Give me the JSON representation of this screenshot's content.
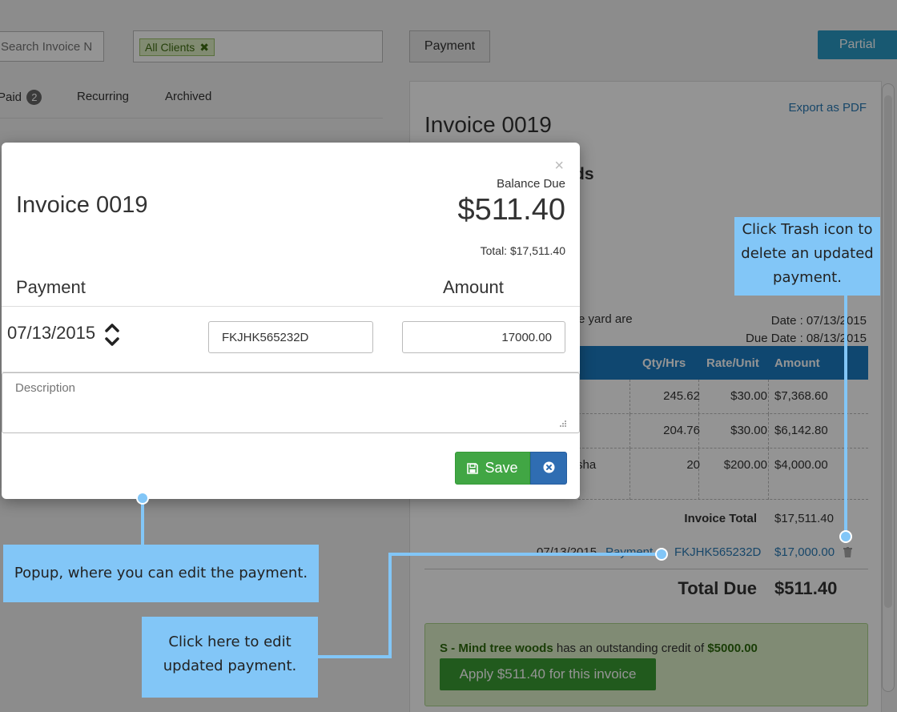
{
  "toolbar": {
    "search_placeholder": "Search Invoice N",
    "client_tag": "All Clients",
    "client_tag_remove": "✖",
    "payment_button": "Payment",
    "partial_button": "Partial"
  },
  "tabs": [
    {
      "label": "Paid",
      "badge": "2"
    },
    {
      "label": "Recurring"
    },
    {
      "label": "Archived"
    }
  ],
  "invoice": {
    "export_link": "Export as PDF",
    "title": "Invoice 0019",
    "client_fragment": "ds",
    "address_fragment": "e yard are",
    "date": "Date : 07/13/2015",
    "due_date": "Due Date : 08/13/2015",
    "columns": {
      "qty": "Qty/Hrs",
      "rate": "Rate/Unit",
      "amount": "Amount"
    },
    "rows": [
      {
        "desc": "",
        "qty": "245.62",
        "rate": "$30.00",
        "amount": "$7,368.60"
      },
      {
        "desc": "",
        "qty": "204.76",
        "rate": "$30.00",
        "amount": "$6,142.80"
      },
      {
        "desc": "sha",
        "qty": "20",
        "rate": "$200.00",
        "amount": "$4,000.00"
      }
    ],
    "invoice_total_label": "Invoice Total",
    "invoice_total": "$17,511.40",
    "payment_date": "07/13/2015",
    "payment_link": "Payment",
    "payment_ref": "FKJHK565232D",
    "payment_amount": "$17,000.00",
    "total_due_label": "Total Due",
    "total_due": "$511.40",
    "credit_client": "S - Mind tree woods",
    "credit_text": "has an outstanding credit of",
    "credit_amount": "$5000.00",
    "apply_button": "Apply $511.40 for this invoice"
  },
  "modal": {
    "close": "×",
    "title": "Invoice 0019",
    "balance_label": "Balance Due",
    "balance_value": "$511.40",
    "total_line": "Total: $17,511.40",
    "col_payment": "Payment",
    "col_amount": "Amount",
    "payment_date": "07/13/2015",
    "reference": "FKJHK565232D",
    "amount": "17000.00",
    "description_placeholder": "Description",
    "save_button": "Save"
  },
  "annotations": {
    "trash": "Click Trash icon to delete an updated payment.",
    "popup": "Popup, where you can edit the payment.",
    "edit": "Click here to edit updated payment."
  },
  "colors": {
    "accent_blue": "#1b7bc1",
    "save_green": "#41a644",
    "cancel_blue": "#2f6db2",
    "callout_blue": "#82c6f7"
  }
}
